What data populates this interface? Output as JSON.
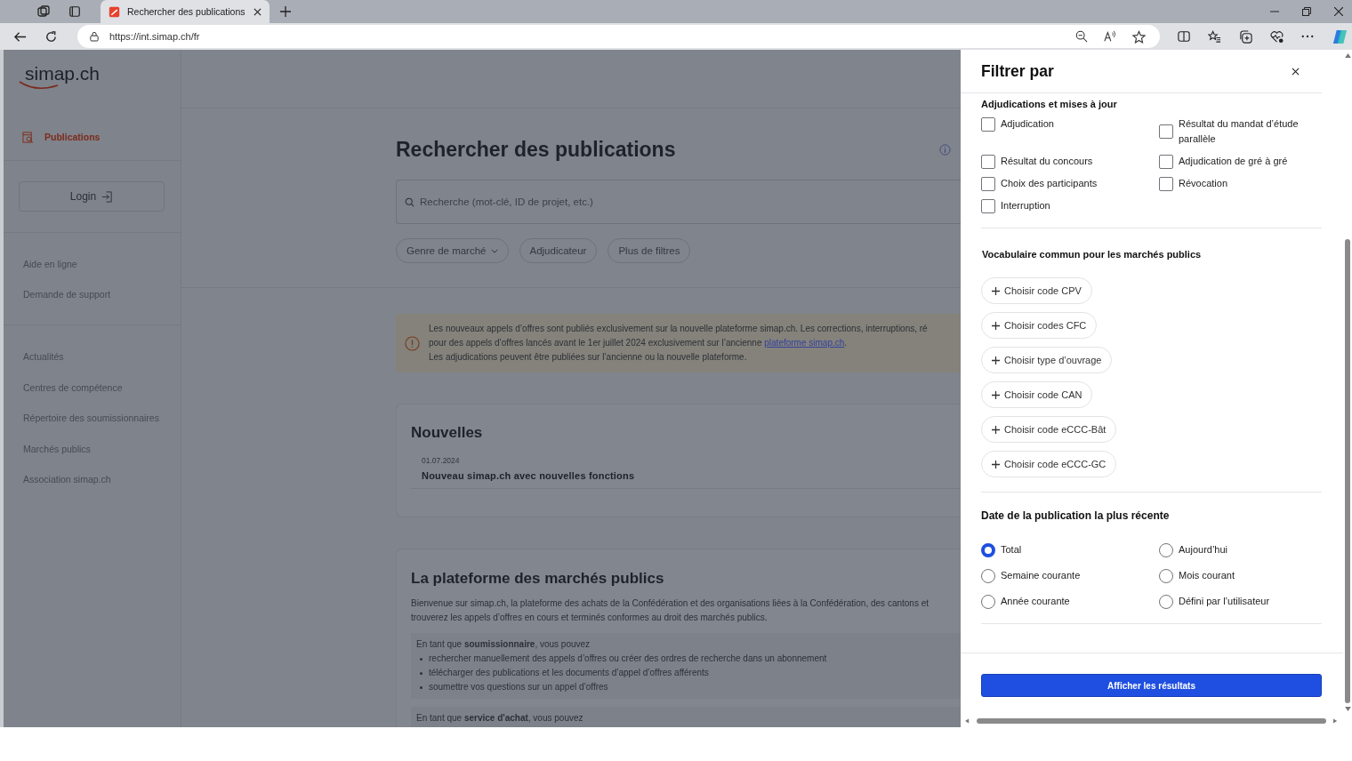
{
  "browser": {
    "tab": {
      "title": "Rechercher des publications"
    },
    "url": "https://int.simap.ch/fr"
  },
  "sidebar": {
    "logo": "simap.ch",
    "nav": [
      {
        "label": "Publications",
        "selected": true
      }
    ],
    "login": "Login",
    "help_links": [
      "Aide en ligne",
      "Demande de support"
    ],
    "links": [
      "Actualités",
      "Centres de compétence",
      "Répertoire des soumissionnaires",
      "Marchés publics",
      "Association simap.ch"
    ]
  },
  "main": {
    "title": "Rechercher des publications",
    "search": {
      "placeholder": "Recherche (mot-clé, ID de projet, etc.)"
    },
    "filters": [
      {
        "label": "Genre de marché",
        "kind": "dropdown"
      },
      {
        "label": "Adjudicateur",
        "kind": "plain"
      },
      {
        "label": "Plus de filtres",
        "kind": "plain"
      }
    ],
    "notice": {
      "line_1": "Les nouveaux appels d’offres sont publiés exclusivement sur la nouvelle plateforme simap.ch. Les corrections, interruptions, ré",
      "line_2": "pour des appels d’offres lancés avant le 1er juillet 2024 exclusivement sur l’ancienne ",
      "link": "plateforme simap.ch",
      "line_2_end": ".",
      "line_3": "Les adjudications peuvent être publiées sur l’ancienne ou la nouvelle plateforme."
    },
    "news": {
      "title": "Nouvelles",
      "items": [
        {
          "date": "01.07.2024",
          "title": "Nouveau simap.ch avec nouvelles fonctions"
        }
      ]
    },
    "platform": {
      "title": "La plateforme des marchés publics",
      "intro_lines": [
        "Bienvenue sur simap.ch, la plateforme des achats de la Confédération et des organisations liées à la Confédération, des cantons et",
        "trouverez les appels d’offres en cours et terminés conformes au droit des marchés publics."
      ],
      "sections": [
        {
          "lead": "En tant que **soumissionnaire**, vous pouvez",
          "bullets": [
            "rechercher manuellement des appels d’offres ou créer des ordres de recherche dans un abonnement",
            "télécharger des publications et les documents d’appel d’offres afférents",
            "soumettre vos questions sur un appel d’offres"
          ]
        },
        {
          "lead": "En tant que **service d'achat**, vous pouvez"
        }
      ]
    }
  },
  "drawer": {
    "title": "Filtrer par",
    "awards": {
      "title": "Adjudications et mises à jour",
      "items": [
        {
          "label": "Adjudication",
          "checked": false
        },
        {
          "label": "Résultat du mandat d’étude parallèle",
          "checked": false
        },
        {
          "label": "Résultat du concours",
          "checked": false
        },
        {
          "label": "Adjudication de gré à gré",
          "checked": false
        },
        {
          "label": "Choix des participants",
          "checked": false
        },
        {
          "label": "Révocation",
          "checked": false
        },
        {
          "label": "Interruption",
          "checked": false
        }
      ]
    },
    "vocabulary": {
      "title": "Vocabulaire commun pour les marchés publics",
      "buttons": [
        "Choisir code CPV",
        "Choisir codes CFC",
        "Choisir type d’ouvrage",
        "Choisir code CAN",
        "Choisir code eCCC-Bât",
        "Choisir code eCCC-GC"
      ]
    },
    "date": {
      "title": "Date de la publication la plus récente",
      "options": [
        {
          "label": "Total",
          "selected": true
        },
        {
          "label": "Aujourd’hui",
          "selected": false
        },
        {
          "label": "Semaine courante",
          "selected": false
        },
        {
          "label": "Mois courant",
          "selected": false
        },
        {
          "label": "Année courante",
          "selected": false
        },
        {
          "label": "Défini par l’utilisateur",
          "selected": false
        }
      ]
    },
    "submit": "Afficher les résultats"
  }
}
